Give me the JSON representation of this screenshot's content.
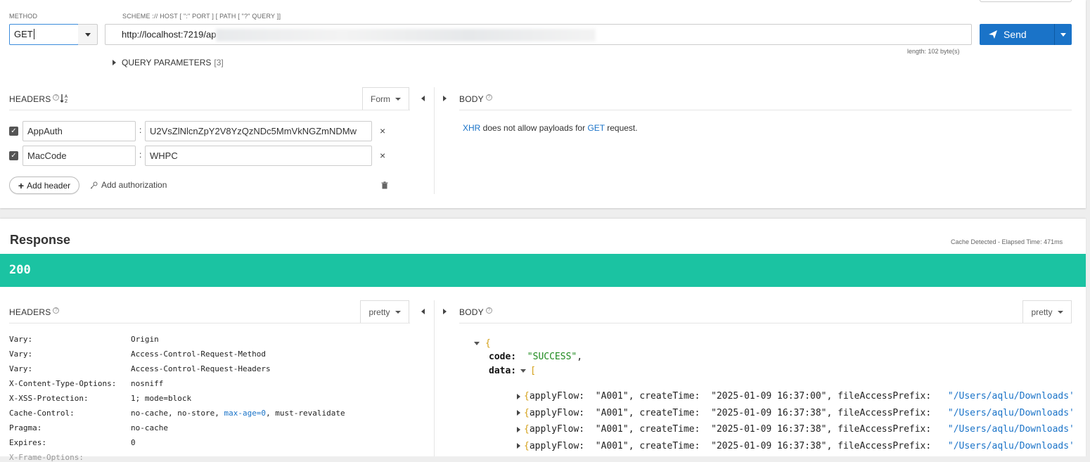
{
  "request": {
    "method_label": "METHOD",
    "method_value": "GET",
    "url_label": "SCHEME :// HOST [ \":\" PORT ] [ PATH [ \"?\" QUERY ]]",
    "url_value": "http://localhost:7219/ap",
    "url_length": "length: 102 byte(s)",
    "send_label": "Send",
    "query_params_label": "QUERY PARAMETERS",
    "query_params_count": "[3]",
    "headers_label": "HEADERS",
    "headers_format": "Form",
    "headers": [
      {
        "name": "AppAuth",
        "value": "U2VsZlNlcnZpY2V8YzQzNDc5MmVkNGZmNDMw",
        "checked": true
      },
      {
        "name": "MacCode",
        "value": "WHPC",
        "checked": true
      }
    ],
    "add_header_label": "Add header",
    "add_authorization_label": "Add authorization",
    "body_label": "BODY",
    "body_message": {
      "link1": "XHR",
      "mid": " does not allow payloads for ",
      "link2": "GET",
      "end": " request."
    }
  },
  "response": {
    "title": "Response",
    "meta": "Cache Detected - Elapsed Time: 471ms",
    "status_code": "200",
    "headers_label": "HEADERS",
    "headers_format": "pretty",
    "body_label": "BODY",
    "body_format": "pretty",
    "headers": [
      {
        "name": "Vary:",
        "value": "Origin"
      },
      {
        "name": "Vary:",
        "value": "Access-Control-Request-Method"
      },
      {
        "name": "Vary:",
        "value": "Access-Control-Request-Headers"
      },
      {
        "name": "X-Content-Type-Options:",
        "value": "nosniff"
      },
      {
        "name": "X-XSS-Protection:",
        "value": "1; mode=block"
      },
      {
        "name": "Cache-Control:",
        "value": "no-cache, no-store, max-age=0, must-revalidate"
      },
      {
        "name": "Pragma:",
        "value": "no-cache"
      },
      {
        "name": "Expires:",
        "value": "0"
      }
    ],
    "json": {
      "code_key": "code:",
      "code_value": "\"SUCCESS\"",
      "data_key": "data:",
      "rows": [
        {
          "applyFlow": "\"A001\"",
          "createTime": "\"2025-01-09 16:37:00\"",
          "prefix": "\"/Users/aqlu/Downloads'"
        },
        {
          "applyFlow": "\"A001\"",
          "createTime": "\"2025-01-09 16:37:38\"",
          "prefix": "\"/Users/aqlu/Downloads'"
        },
        {
          "applyFlow": "\"A001\"",
          "createTime": "\"2025-01-09 16:37:38\"",
          "prefix": "\"/Users/aqlu/Downloads'"
        },
        {
          "applyFlow": "\"A001\"",
          "createTime": "\"2025-01-09 16:37:38\"",
          "prefix": "\"/Users/aqlu/Downloads'"
        }
      ]
    }
  }
}
